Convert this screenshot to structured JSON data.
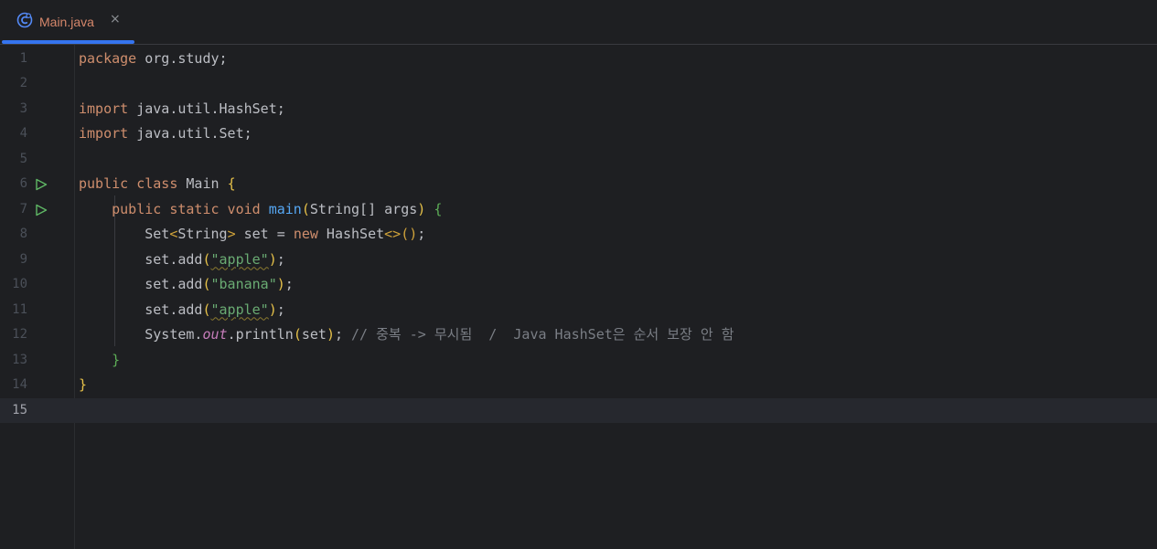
{
  "tab": {
    "label": "Main.java",
    "close": "×",
    "icon": "java-class-icon"
  },
  "editor": {
    "current_line": 15,
    "line_numbers": [
      "1",
      "2",
      "3",
      "4",
      "5",
      "6",
      "7",
      "8",
      "9",
      "10",
      "11",
      "12",
      "13",
      "14",
      "15"
    ],
    "run_gutter_lines": [
      6,
      7
    ],
    "lines": {
      "l1": {
        "kw": "package",
        "rest": " org.study;"
      },
      "l3": {
        "kw": "import",
        "rest": " java.util.HashSet;"
      },
      "l4": {
        "kw": "import",
        "rest": " java.util.Set;"
      },
      "l6": {
        "kw": "public class",
        "name": " Main ",
        "brace": "{"
      },
      "l7": {
        "kw": "public static void",
        "fn": "main",
        "open": "(",
        "params": "String[] args",
        "close": ")",
        "brace": "{"
      },
      "l8": {
        "type": "Set",
        "lt": "<",
        "gen": "String",
        "gt": ">",
        "mid": " set = ",
        "kw": "new",
        "ctor": " HashSet",
        "diamond": "<>",
        "call": "()",
        "end": ";"
      },
      "l9": {
        "pre": "set.add",
        "open": "(",
        "arg": "\"apple\"",
        "close": ")",
        "end": ";"
      },
      "l10": {
        "pre": "set.add",
        "open": "(",
        "arg": "\"banana\"",
        "close": ")",
        "end": ";"
      },
      "l11": {
        "pre": "set.add",
        "open": "(",
        "arg": "\"apple\"",
        "close": ")",
        "end": ";"
      },
      "l12": {
        "pre": "System.",
        "field": "out",
        "method": ".println",
        "open": "(",
        "arg": "set",
        "close": ")",
        "end": "; ",
        "comment": "// 중복 -> 무시됨  /  Java HashSet은 순서 보장 안 함"
      },
      "l13": {
        "brace": "}"
      },
      "l14": {
        "brace": "}"
      }
    }
  },
  "colors": {
    "background": "#1e1f22",
    "keyword": "#cf8e6d",
    "string": "#6aab73",
    "function": "#56a8f5",
    "static_field": "#c77dbb",
    "comment": "#7a7e85",
    "tab_accent": "#3574f0"
  }
}
